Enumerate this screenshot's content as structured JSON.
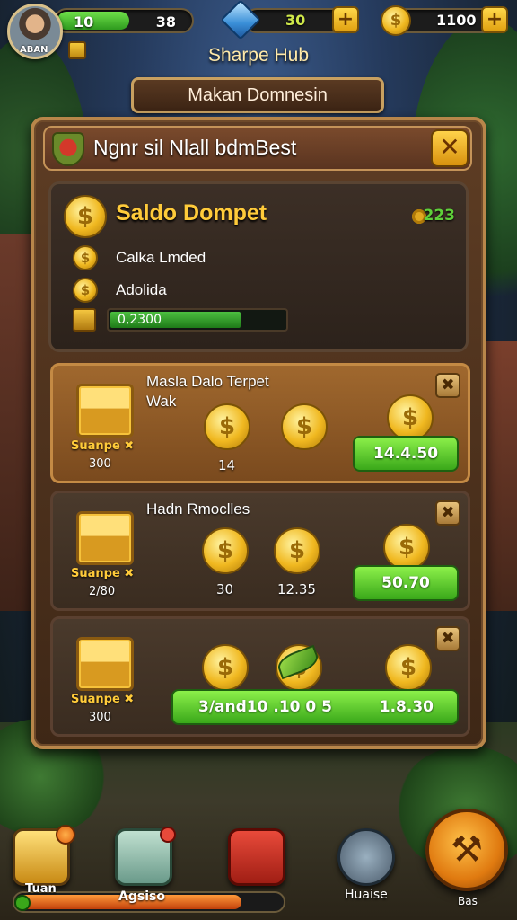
{
  "hud": {
    "avatar_name": "ABAN",
    "xp_level": "10",
    "xp_value": "38",
    "gem_value": "30",
    "coin_value": "1100",
    "plus_label": "+",
    "coin_symbol": "$"
  },
  "header": {
    "hub_title": "Sharpe Hub",
    "subtitle": "Makan Domnesin"
  },
  "panel": {
    "title": "Ngnr sil Nlall bdmBest",
    "close_label": "✕"
  },
  "balance": {
    "title": "Saldo Dompet",
    "amount": "223",
    "line1": "Calka Lmded",
    "line2": "Adolida",
    "progress_label": "0,2300",
    "progress_fraction": 0.75
  },
  "offers": [
    {
      "title": "Masla Dalo Terpet",
      "title2": "Wak",
      "chest_label": "Suanpe ✖",
      "chest_sub": "300",
      "coin_caption": "14",
      "buy_label": "14.4.50",
      "close_label": "✖"
    },
    {
      "title": "Hadn Rmoclles",
      "chest_label": "Suanpe ✖",
      "chest_sub": "2/80",
      "coin_caption_1": "30",
      "coin_caption_2": "12.35",
      "buy_label": "50.70",
      "close_label": "✖"
    },
    {
      "chest_label": "Suanpe ✖",
      "chest_sub": "300",
      "buy_label_left": "3/and10 .10 0 5",
      "buy_label_right": "1.8.30",
      "close_label": "✖"
    }
  ],
  "dock": {
    "left_label": "Tuan",
    "mid_label": "Agsiso",
    "shield_label": "Huaise",
    "action_label": "Bas",
    "progress_fraction": 0.85
  }
}
